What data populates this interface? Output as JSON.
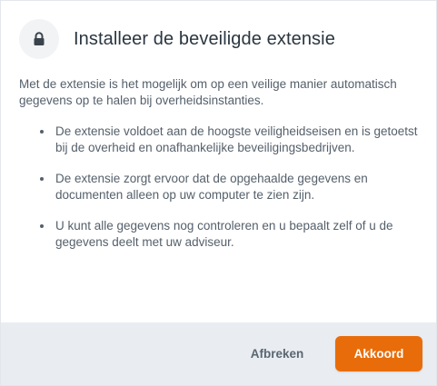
{
  "dialog": {
    "icon": "lock-icon",
    "title": "Installeer de beveiligde extensie",
    "intro": "Met de extensie is het mogelijk om op een veilige manier automatisch gegevens op te halen bij overheidsinstanties.",
    "bullets": [
      "De extensie voldoet aan de hoogste veiligheidseisen en is getoetst bij de overheid en onafhankelijke beveiligingsbedrijven.",
      "De extensie zorgt ervoor dat de opgehaalde gegevens en documenten alleen op uw computer te zien zijn.",
      "U kunt alle gegevens nog controleren en u bepaalt zelf of u de gegevens deelt met uw adviseur."
    ]
  },
  "footer": {
    "cancel_label": "Afbreken",
    "confirm_label": "Akkoord"
  },
  "colors": {
    "accent": "#e86d0a",
    "footer_bg": "#e9edf2",
    "text": "#55606b",
    "title": "#2b3640"
  }
}
